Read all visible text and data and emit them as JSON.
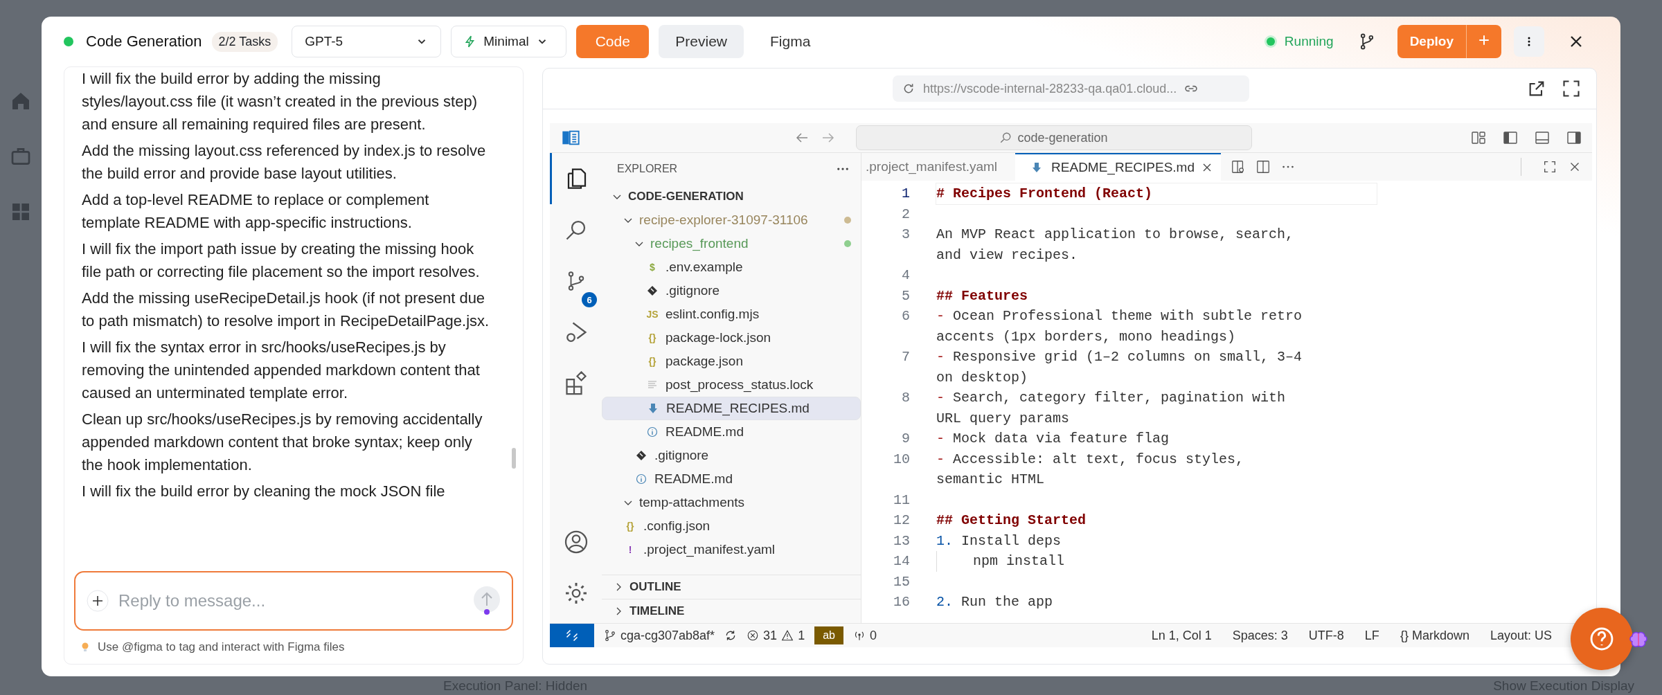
{
  "backdrop": {
    "footer_left": "Execution Panel: Hidden",
    "footer_right": "Show Execution Display"
  },
  "header": {
    "title": "Code Generation",
    "tasks_badge": "2/2 Tasks",
    "model": "GPT-5",
    "mode": "Minimal",
    "view_tabs": [
      {
        "label": "Code",
        "selected": true,
        "hovered": false
      },
      {
        "label": "Preview",
        "selected": false,
        "hovered": true
      },
      {
        "label": "Figma",
        "selected": false,
        "hovered": false
      }
    ],
    "status": "Running",
    "deploy": "Deploy"
  },
  "chat": {
    "messages": [
      "I will fix the build error by adding the missing styles/layout.css file (it wasn’t created in the previous step) and ensure all remaining required files are present.",
      "Add the missing layout.css referenced by index.js to resolve the build error and provide base layout utilities.",
      "Add a top-level README to replace or complement template README with app-specific instructions.",
      "I will fix the import path issue by creating the missing hook file path or correcting file placement so the import resolves.",
      "Add the missing useRecipeDetail.js hook (if not present due to path mismatch) to resolve import in RecipeDetailPage.jsx.",
      "I will fix the syntax error in src/hooks/useRecipes.js by removing the unintended appended markdown content that caused an unterminated template error.",
      "Clean up src/hooks/useRecipes.js by removing accidentally appended markdown content that broke syntax; keep only the hook implementation.",
      "I will fix the build error by cleaning the mock JSON file"
    ],
    "input": {
      "placeholder": "Reply to message..."
    },
    "hint": "Use @figma to tag and interact with Figma files"
  },
  "preview": {
    "url": "https://vscode-internal-28233-qa.qa01.cloud..."
  },
  "vscode": {
    "command_center": "code-generation",
    "scm_badge": "6",
    "explorer": {
      "title": "EXPLORER",
      "tree": [
        {
          "name": "CODE-GENERATION",
          "kind": "root",
          "expanded": true,
          "children": [
            {
              "name": "recipe-explorer-31097-31106",
              "kind": "folder",
              "expanded": true,
              "color": "#cdbb93",
              "children": [
                {
                  "name": "recipes_frontend",
                  "kind": "folder",
                  "expanded": true,
                  "color": "#8fcf8f",
                  "children": [
                    {
                      "name": ".env.example",
                      "kind": "env",
                      "glyph": "$",
                      "selected": false
                    },
                    {
                      "name": ".gitignore",
                      "kind": "git",
                      "selected": false
                    },
                    {
                      "name": "eslint.config.mjs",
                      "kind": "js",
                      "glyph": "JS",
                      "selected": false
                    },
                    {
                      "name": "package-lock.json",
                      "kind": "json",
                      "glyph": "{}",
                      "selected": false
                    },
                    {
                      "name": "package.json",
                      "kind": "json",
                      "glyph": "{}",
                      "selected": false
                    },
                    {
                      "name": "post_process_status.lock",
                      "kind": "lines",
                      "selected": false
                    },
                    {
                      "name": "README_RECIPES.md",
                      "kind": "markdown",
                      "selected": true
                    },
                    {
                      "name": "README.md",
                      "kind": "info",
                      "selected": false
                    }
                  ]
                },
                {
                  "name": ".gitignore",
                  "kind": "git",
                  "selected": false
                },
                {
                  "name": "README.md",
                  "kind": "info",
                  "selected": false
                }
              ]
            },
            {
              "name": "temp-attachments",
              "kind": "folder",
              "expanded": true
            },
            {
              "name": ".config.json",
              "kind": "json",
              "glyph": "{}",
              "selected": false
            },
            {
              "name": ".project_manifest.yaml",
              "kind": "yaml",
              "glyph": "!",
              "selected": false
            }
          ]
        }
      ]
    },
    "sections": [
      {
        "label": "OUTLINE",
        "expanded": false
      },
      {
        "label": "TIMELINE",
        "expanded": false
      }
    ],
    "tabs": [
      {
        "label": ".project_manifest.yaml",
        "selected": false
      },
      {
        "label": "README_RECIPES.md",
        "selected": true
      }
    ],
    "lines": [
      {
        "num": "1",
        "kind": "heading",
        "text": "# Recipes Frontend (React)",
        "current": true
      },
      {
        "num": "2",
        "kind": "text",
        "current": false
      },
      {
        "num": "3",
        "kind": "text",
        "text": "An MVP React application to browse, search, and view recipes.",
        "current": false
      },
      {
        "num": "4",
        "kind": "text",
        "current": false
      },
      {
        "num": "5",
        "kind": "heading",
        "text": "## Features",
        "current": false
      },
      {
        "num": "6",
        "kind": "bullet",
        "marker": "-",
        "text": "Ocean Professional theme with subtle retro accents (1px borders, mono headings)",
        "current": false
      },
      {
        "num": "7",
        "kind": "bullet",
        "marker": "-",
        "text": "Responsive grid (1–2 columns on small, 3–4 on desktop)",
        "current": false
      },
      {
        "num": "8",
        "kind": "bullet",
        "marker": "-",
        "text": "Search, category filter, pagination with URL query params",
        "current": false
      },
      {
        "num": "9",
        "kind": "bullet",
        "marker": "-",
        "text": "Mock data via feature flag",
        "current": false
      },
      {
        "num": "10",
        "kind": "bullet",
        "marker": "-",
        "text": "Accessible: alt text, focus styles, semantic HTML",
        "current": false
      },
      {
        "num": "11",
        "kind": "text",
        "current": false
      },
      {
        "num": "12",
        "kind": "heading",
        "text": "## Getting Started",
        "current": false
      },
      {
        "num": "13",
        "kind": "numbered",
        "marker": "1.",
        "text": "Install deps",
        "current": false
      },
      {
        "num": "14",
        "kind": "indent",
        "text": "npm install",
        "current": false
      },
      {
        "num": "15",
        "kind": "text",
        "current": false
      },
      {
        "num": "16",
        "kind": "numbered",
        "marker": "2.",
        "text": "Run the app",
        "current": false
      }
    ],
    "status_bar": {
      "branch": "cga-cg307ab8af*",
      "errors": "31",
      "warnings": "1",
      "ab": "ab",
      "ports": "0",
      "right": [
        {
          "label": "Ln 1, Col 1"
        },
        {
          "label": "Spaces: 3"
        },
        {
          "label": "UTF-8"
        },
        {
          "label": "LF"
        },
        {
          "glyph": "{}",
          "label": "Markdown"
        },
        {
          "label": "Layout: US"
        }
      ]
    }
  }
}
